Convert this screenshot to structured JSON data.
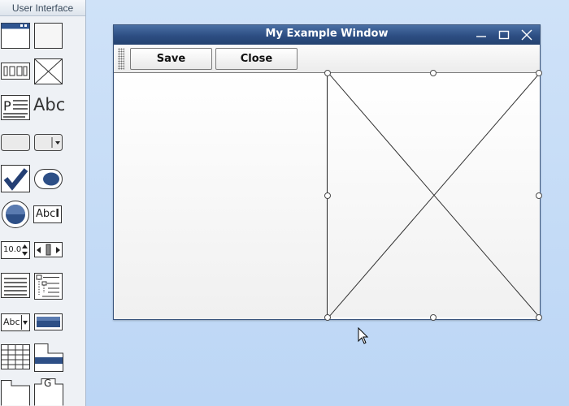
{
  "palette": {
    "header": "User Interface",
    "items": [
      {
        "name": "window-widget-icon"
      },
      {
        "name": "panel-widget-icon"
      },
      {
        "name": "button-bar-widget-icon"
      },
      {
        "name": "image-placeholder-widget-icon"
      },
      {
        "name": "paragraph-widget-icon"
      },
      {
        "name": "label-widget-icon",
        "text": "Abc"
      },
      {
        "name": "button-widget-icon"
      },
      {
        "name": "split-button-widget-icon"
      },
      {
        "name": "checkbox-widget-icon"
      },
      {
        "name": "toggle-widget-icon"
      },
      {
        "name": "radio-widget-icon"
      },
      {
        "name": "text-field-widget-icon",
        "text": "Abc"
      },
      {
        "name": "numeric-stepper-widget-icon",
        "text": "10.0"
      },
      {
        "name": "slider-widget-icon"
      },
      {
        "name": "list-widget-icon"
      },
      {
        "name": "tree-widget-icon"
      },
      {
        "name": "combobox-widget-icon",
        "text": "Abc"
      },
      {
        "name": "progress-bar-widget-icon"
      },
      {
        "name": "table-widget-icon"
      },
      {
        "name": "tab-panel-widget-icon"
      },
      {
        "name": "folder-widget-icon"
      },
      {
        "name": "group-widget-icon",
        "text": "G"
      }
    ]
  },
  "window": {
    "title": "My Example Window",
    "toolbar": {
      "save_label": "Save",
      "close_label": "Close"
    }
  },
  "colors": {
    "canvas": "#c4dbf6",
    "titlebar": "#2d4e83",
    "accent": "#2b4f86"
  }
}
